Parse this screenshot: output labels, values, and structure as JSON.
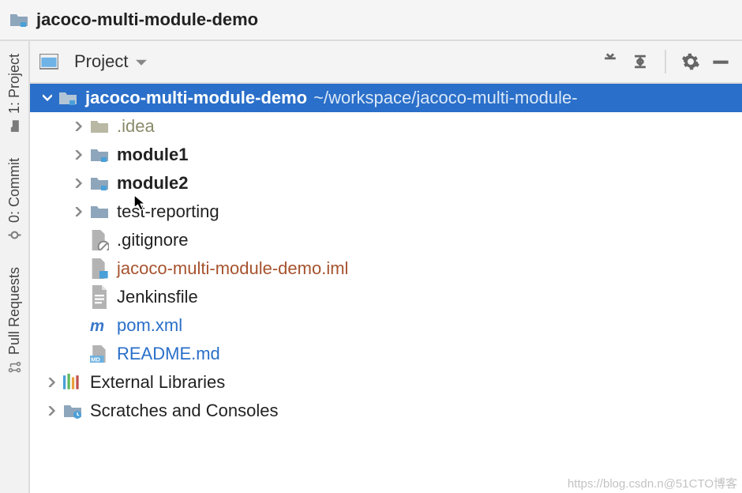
{
  "breadcrumb": {
    "project_name": "jacoco-multi-module-demo"
  },
  "toolbar": {
    "project_label": "Project"
  },
  "left_tabs": {
    "project": "1: Project",
    "commit": "0: Commit",
    "pull_requests": "Pull Requests"
  },
  "tree": {
    "root": {
      "name": "jacoco-multi-module-demo",
      "path": "~/workspace/jacoco-multi-module-"
    },
    "items": [
      {
        "name": ".idea",
        "dim": true,
        "folder": true,
        "expandable": true
      },
      {
        "name": "module1",
        "bold": true,
        "folder": true,
        "module": true,
        "expandable": true
      },
      {
        "name": "module2",
        "bold": true,
        "folder": true,
        "module": true,
        "expandable": true
      },
      {
        "name": "test-reporting",
        "folder": true,
        "expandable": true
      },
      {
        "name": ".gitignore",
        "file": true
      },
      {
        "name": "jacoco-multi-module-demo.iml",
        "file": true,
        "orange": true
      },
      {
        "name": "Jenkinsfile",
        "file": true
      },
      {
        "name": "pom.xml",
        "file": true,
        "maven": true,
        "blue": true
      },
      {
        "name": "README.md",
        "file": true,
        "md": true,
        "blue": true
      }
    ],
    "external_libraries": "External Libraries",
    "scratches": "Scratches and Consoles"
  },
  "watermark": "https://blog.csdn.n@51CTO博客"
}
